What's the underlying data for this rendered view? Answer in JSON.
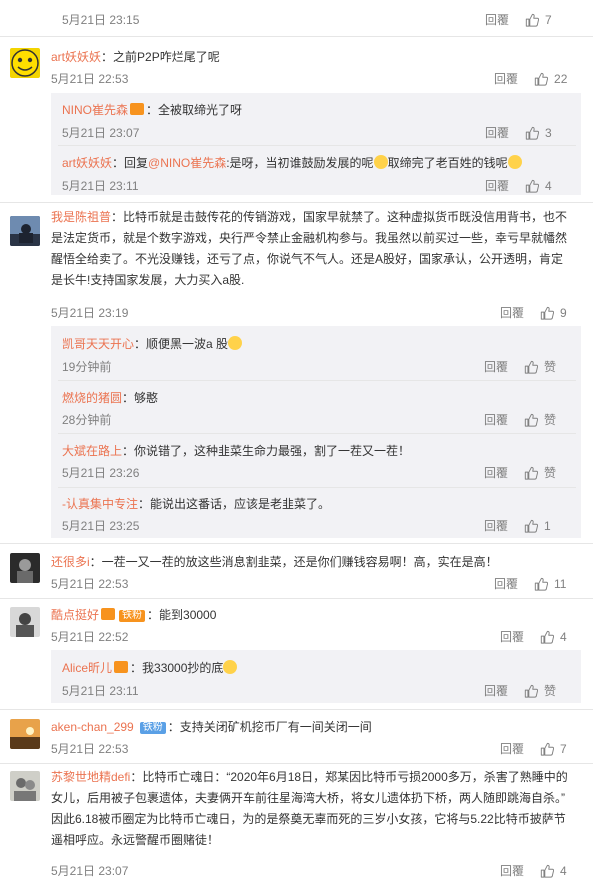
{
  "ui": {
    "reply": "回覆",
    "like_icon": "thumbs-up-icon",
    "accent": "#eb7350",
    "text": "#333333",
    "meta": "#808080",
    "sub_bg": "#f2f2f5"
  },
  "c0": {
    "time": "5月21日 23:15",
    "likes": "7"
  },
  "c1": {
    "user": "art妖妖妖",
    "text": "：之前P2P咋烂尾了呢",
    "time": "5月21日 22:53",
    "likes": "22",
    "r1": {
      "user": "NINO崔先森",
      "text": "：全被取缔光了呀",
      "time": "5月21日 23:07",
      "likes": "3"
    },
    "r2": {
      "user": "art妖妖妖",
      "pre": "：回复",
      "mention": "@NINO崔先森",
      "mid": ":是呀，当初谁鼓励发展的呢",
      "end": "取缔完了老百姓的钱呢",
      "time": "5月21日 23:11",
      "likes": "4"
    }
  },
  "c2": {
    "user": "我是陈祖普",
    "l1": "：比特币就是击鼓传花的传销游戏，国家早就禁了。这种虚拟货币既没信用背书，也不",
    "l2": "是法定货币，就是个数字游戏，央行严令禁止金融机构参与。我虽然以前买过一些，幸亏早就幡然",
    "l3": "醒悟全给卖了。不光没赚钱，还亏了点，你说气不气人。还是A股好，国家承认，公开透明，肯定",
    "l4": "是长牛!支持国家发展，大力买入a股.",
    "time": "5月21日 23:19",
    "likes": "9",
    "r1": {
      "user": "凯哥天天开心",
      "text": "：顺便黑一波a 股",
      "time": "19分钟前",
      "likes": "赞"
    },
    "r2": {
      "user": "燃烧的猪圆",
      "text": "：够憨",
      "time": "28分钟前",
      "likes": "赞"
    },
    "r3": {
      "user": "大斌在路上",
      "text": "：你说错了，这种韭菜生命力最强，割了一茬又一茬！",
      "time": "5月21日 23:26",
      "likes": "赞"
    },
    "r4": {
      "user": "-认真集中专注",
      "text": "：能说出这番话，应该是老韭菜了。",
      "time": "5月21日 23:25",
      "likes": "1"
    }
  },
  "c3": {
    "user": "还很多i",
    "text": "：一茬一又一茬的放这些消息割韭菜，还是你们赚钱容易啊！高，实在是高！",
    "time": "5月21日 22:53",
    "likes": "11"
  },
  "c4": {
    "user": "酷点挺好",
    "badge": "铁粉",
    "text": "：能到30000",
    "time": "5月21日 22:52",
    "likes": "4",
    "r1": {
      "user": "Alice昕儿",
      "text": "：我33000抄的底",
      "time": "5月21日 23:11",
      "likes": "赞"
    }
  },
  "c5": {
    "user": "aken-chan_299",
    "badge": "铁粉",
    "text": "：支持关闭矿机挖币厂有一间关闭一间",
    "time": "5月21日 22:53",
    "likes": "7"
  },
  "c6": {
    "user": "苏黎世地精defi",
    "l1": "：比特币亡魂日：“2020年6月18日，郑某因比特币亏损2000多万，杀害了熟睡中的",
    "l2": "女儿，后用被子包裹遗体，夫妻俩开车前往星海湾大桥，将女儿遗体扔下桥，两人随即跳海自杀。”",
    "l3": "因此6.18被币圈定为比特币亡魂日，为的是祭奠无辜而死的三岁小女孩，它将与5.22比特币披萨节",
    "l4": "遥相呼应。永远警醒币圈赌徒！",
    "time": "5月21日 23:07",
    "likes": "4"
  }
}
